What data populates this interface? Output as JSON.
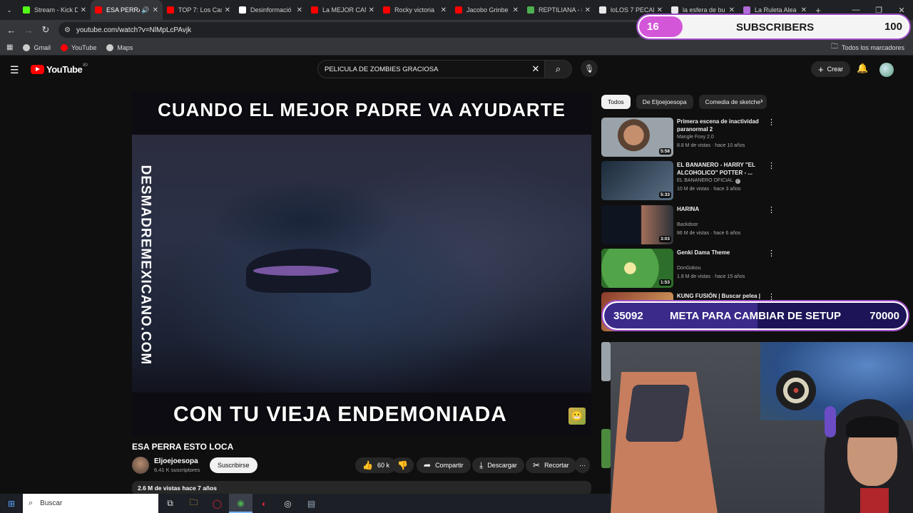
{
  "browser": {
    "tabs": [
      {
        "title": "Stream - Kick D",
        "color": "#53fc18",
        "active": false
      },
      {
        "title": "ESA PERRA",
        "color": "#ff0000",
        "active": true,
        "sound": true
      },
      {
        "title": "TOP 7: Los Cas",
        "color": "#ff0000",
        "active": false
      },
      {
        "title": "Desinformació",
        "color": "#ffffff",
        "active": false
      },
      {
        "title": "La MEJOR CAN",
        "color": "#ff0000",
        "active": false
      },
      {
        "title": "Rocky victoria",
        "color": "#ff0000",
        "active": false
      },
      {
        "title": "Jacobo Grinbe",
        "color": "#ff0000",
        "active": false
      },
      {
        "title": "REPTILIANA - B",
        "color": "#4caf50",
        "active": false
      },
      {
        "title": "loLOS 7 PECAD",
        "color": "#e8e8e8",
        "active": false
      },
      {
        "title": "la esfera de bu",
        "color": "#e8e8e8",
        "active": false
      },
      {
        "title": "La Ruleta Alea",
        "color": "#b06bd8",
        "active": false
      }
    ],
    "url": "youtube.com/watch?v=NlMpLcPAvjk",
    "bookmarks": [
      {
        "label": "Gmail",
        "color": "#cccccc"
      },
      {
        "label": "YouTube",
        "color": "#ff0000"
      },
      {
        "label": "Maps",
        "color": "#cccccc"
      }
    ],
    "all_bookmarks": "Todos los marcadores"
  },
  "subscriber_goal": {
    "current": "16",
    "label": "SUBSCRIBERS",
    "goal": "100",
    "progress": 0.16
  },
  "youtube": {
    "logo_text": "YouTube",
    "logo_badge": "80",
    "search_query": "PELICULA DE ZOMBIES GRACIOSA",
    "create_label": "Crear"
  },
  "video": {
    "caption_top": "CUANDO EL MEJOR PADRE VA AYUDARTE",
    "caption_bottom": "CON TU VIEJA ENDEMONIADA",
    "side_text": "DESMADREMEXICANO.COM",
    "title": "ESA PERRA ESTO LOCA",
    "channel": "Eljoejoesopa",
    "channel_subs": "6.41 K suscriptores",
    "subscribe_label": "Suscribirse",
    "likes": "60 k",
    "share_label": "Compartir",
    "download_label": "Descargar",
    "clip_label": "Recortar",
    "stats": "2.6 M de vistas  hace 7 años"
  },
  "chips": [
    "Todos",
    "De Eljoejoesopa",
    "Comedia de sketche"
  ],
  "recommendations": [
    {
      "title": "Primera escena de inactividad paranormal 2",
      "channel": "Mangle Foxy 2.0",
      "meta": "8.8 M de vistas · hace 10 años",
      "duration": "5:58",
      "verified": false
    },
    {
      "title": "EL BANANERO - HARRY \"EL ALCOHOLICO\" POTTER - ...",
      "channel": "EL BANANERO OFICIAL",
      "meta": "10 M de vistas · hace 3 años",
      "duration": "5:33",
      "verified": true
    },
    {
      "title": "HARINA",
      "channel": "Backdoor",
      "meta": "86 M de vistas · hace 6 años",
      "duration": "3:03",
      "verified": false
    },
    {
      "title": "Genki Dama Theme",
      "channel": "DonGokou",
      "meta": "1.8 M de vistas · hace 15 años",
      "duration": "1:53",
      "verified": false
    },
    {
      "title": "KUNG FUSIÓN | Buscar pelea |",
      "channel": "",
      "meta": "",
      "duration": "",
      "verified": false
    }
  ],
  "setup_goal": {
    "current": "35092",
    "label": "META PARA CAMBIAR DE SETUP",
    "target": "70000",
    "progress": 0.5013
  },
  "taskbar": {
    "search_placeholder": "Buscar"
  }
}
